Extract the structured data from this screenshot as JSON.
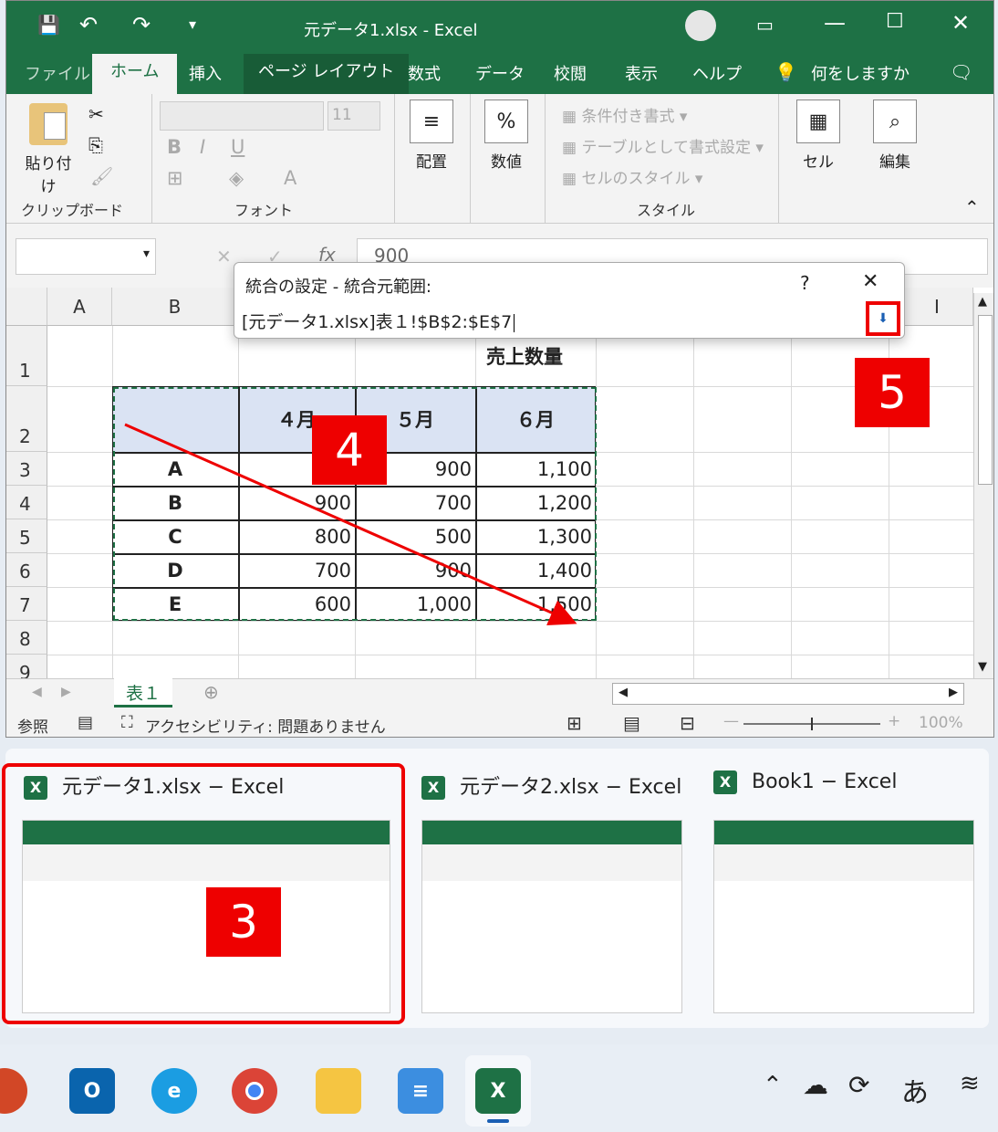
{
  "window": {
    "title": "元データ1.xlsx  -  Excel"
  },
  "tabs": [
    "ファイル",
    "ホーム",
    "挿入",
    "ページ レイアウト",
    "数式",
    "データ",
    "校閲",
    "表示",
    "ヘルプ"
  ],
  "tell_me": "何をしますか",
  "ribbon": {
    "clipboard": {
      "paste": "貼り付け",
      "label": "クリップボード"
    },
    "font": {
      "size": "11",
      "label": "フォント",
      "bold": "B",
      "italic": "I",
      "underline": "U"
    },
    "align": "配置",
    "number": "数値",
    "styles": {
      "conditional": "条件付き書式",
      "as_table": "テーブルとして書式設定",
      "cell_styles": "セルのスタイル",
      "label": "スタイル"
    },
    "cells": "セル",
    "edit": "編集"
  },
  "formula_bar": {
    "value": "900",
    "fx": "fx"
  },
  "dialog": {
    "title": "統合の設定 - 統合元範囲:",
    "help": "?",
    "range": "[元データ1.xlsx]表１!$B$2:$E$7"
  },
  "columns": [
    "A",
    "B",
    "",
    "",
    "",
    "",
    "",
    "",
    "I"
  ],
  "rows": [
    "1",
    "2",
    "3",
    "4",
    "5",
    "6",
    "7",
    "8",
    "9"
  ],
  "sheet": {
    "title": "売上数量",
    "headers": [
      "４月",
      "５月",
      "６月"
    ],
    "row_labels": [
      "A",
      "B",
      "C",
      "D",
      "E"
    ],
    "apr": [
      "1",
      "900",
      "800",
      "700",
      "600"
    ],
    "may": [
      "900",
      "700",
      "500",
      "900",
      "1,000"
    ],
    "jun": [
      "1,100",
      "1,200",
      "1,300",
      "1,400",
      "1,500"
    ]
  },
  "sheet_tab": "表１",
  "status": {
    "mode": "参照",
    "accessibility": "アクセシビリティ: 問題ありません",
    "zoom": "100%"
  },
  "preview": [
    {
      "title": "元データ1.xlsx − Excel"
    },
    {
      "title": "元データ2.xlsx − Excel"
    },
    {
      "title": "Book1  − Excel"
    }
  ],
  "markers": [
    "3",
    "4",
    "5"
  ],
  "tray": {
    "ime": "あ"
  },
  "colors": {
    "excel_green": "#1e7145",
    "marker_red": "#ee0000",
    "header_fill": "#dae3f3"
  }
}
